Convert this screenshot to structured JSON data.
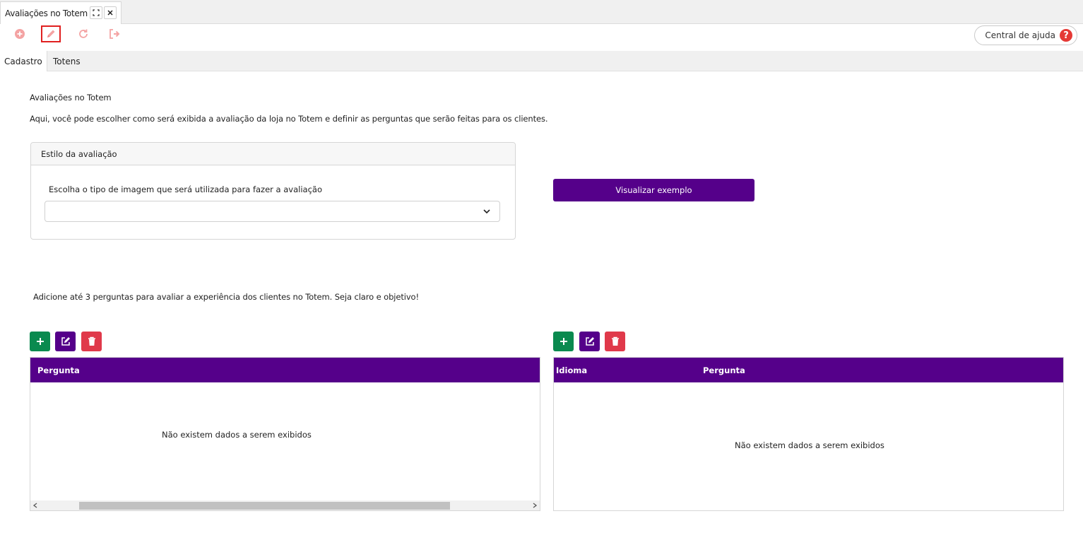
{
  "window": {
    "tab_title": "Avaliações no Totem"
  },
  "toolbar": {
    "help_label": "Central de ajuda",
    "help_glyph": "?",
    "icons": [
      "plus-circle-icon",
      "pencil-icon",
      "refresh-icon",
      "exit-icon"
    ],
    "colors": {
      "icon": "#f08080",
      "selected_border": "#e02020"
    }
  },
  "subtabs": [
    {
      "label": "Cadastro",
      "active": true
    },
    {
      "label": "Totens",
      "active": false
    }
  ],
  "main": {
    "title": "Avaliações no Totem",
    "description": "Aqui, você pode escolher como será exibida a avaliação da loja no Totem e definir as perguntas que serão feitas para os clientes.",
    "style_panel": {
      "header": "Estilo da avaliação",
      "label": "Escolha o tipo de imagem que será utilizada para fazer a avaliação",
      "select_value": ""
    },
    "preview_button": "Visualizar exemplo",
    "questions_hint": "Adicione até 3 perguntas para avaliar a experiência dos clientes no Totem. Seja claro e objetivo!"
  },
  "left_grid": {
    "columns": [
      "Pergunta"
    ],
    "empty_message": "Não existem dados a serem exibidos"
  },
  "right_grid": {
    "columns": [
      "Idioma",
      "Pergunta"
    ],
    "empty_message": "Não existem dados a serem exibidos"
  },
  "colors": {
    "brand_purple": "#55008a",
    "add_green": "#0a8a4f",
    "delete_red": "#e0394a",
    "help_red": "#e53935"
  }
}
